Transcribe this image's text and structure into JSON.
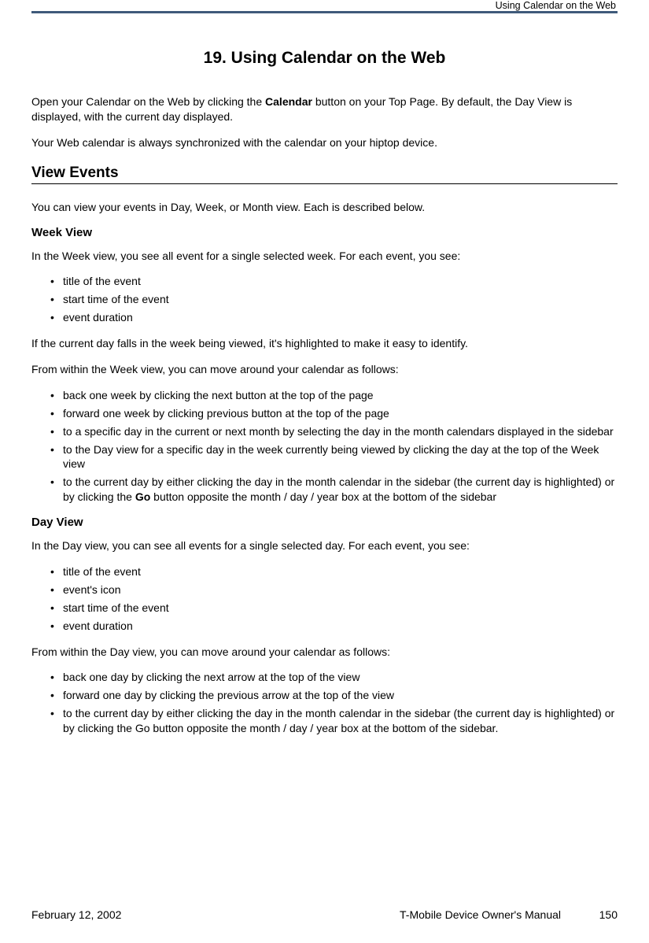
{
  "header": {
    "section": "Using Calendar on the Web"
  },
  "chapter": {
    "title": "19.  Using Calendar on the Web"
  },
  "intro": {
    "p1_a": "Open your Calendar on the Web by clicking the ",
    "p1_b": "Calendar",
    "p1_c": " button on your Top Page. By default, the Day View is displayed, with the current day displayed.",
    "p2": "Your Web calendar is always synchronized with the calendar on your hiptop device."
  },
  "h2_view_events": "View Events",
  "view_events_intro": "You can view your events in Day, Week, or Month view. Each is described below.",
  "week": {
    "heading": "Week View",
    "intro": "In the Week view, you see all event for a single selected week. For each event, you see:",
    "list1": [
      "title of the event",
      "start time of the event",
      "event duration"
    ],
    "p2": "If the current day falls in the week being viewed, it's highlighted to make it easy to identify.",
    "p3": "From within the Week view, you can move around your calendar as follows:",
    "list2": {
      "i0": "back one week by clicking the next button at the top of the page",
      "i1": "forward one week by clicking previous button at the top of the page",
      "i2": "to a specific day in the current or next month by selecting the day in the month calendars displayed in the sidebar",
      "i3": "to the Day view for a specific day in the week currently being viewed by clicking the day at the top of the Week view",
      "i4_a": "to the current day by either clicking the day in the month calendar in the sidebar (the current day is highlighted) or by clicking the ",
      "i4_b": "Go",
      "i4_c": " button opposite the month / day / year box at the bottom of the sidebar"
    }
  },
  "day": {
    "heading": "Day View",
    "intro": "In the Day view, you can see all events for a single selected day. For each event, you see:",
    "list1": [
      "title of the event",
      "event's icon",
      "start time of the event",
      "event duration"
    ],
    "p2": "From within the Day view, you can move around your calendar as follows:",
    "list2": [
      "back one day by clicking the next arrow at the top of the view",
      "forward one day by clicking the previous arrow at the top of the view",
      "to the current day by either clicking the day in the month calendar in the sidebar (the current day is highlighted) or by clicking the Go button opposite the month / day / year box at the bottom of the sidebar."
    ]
  },
  "footer": {
    "date": "February 12, 2002",
    "manual": "T-Mobile Device Owner's Manual",
    "page": "150"
  }
}
